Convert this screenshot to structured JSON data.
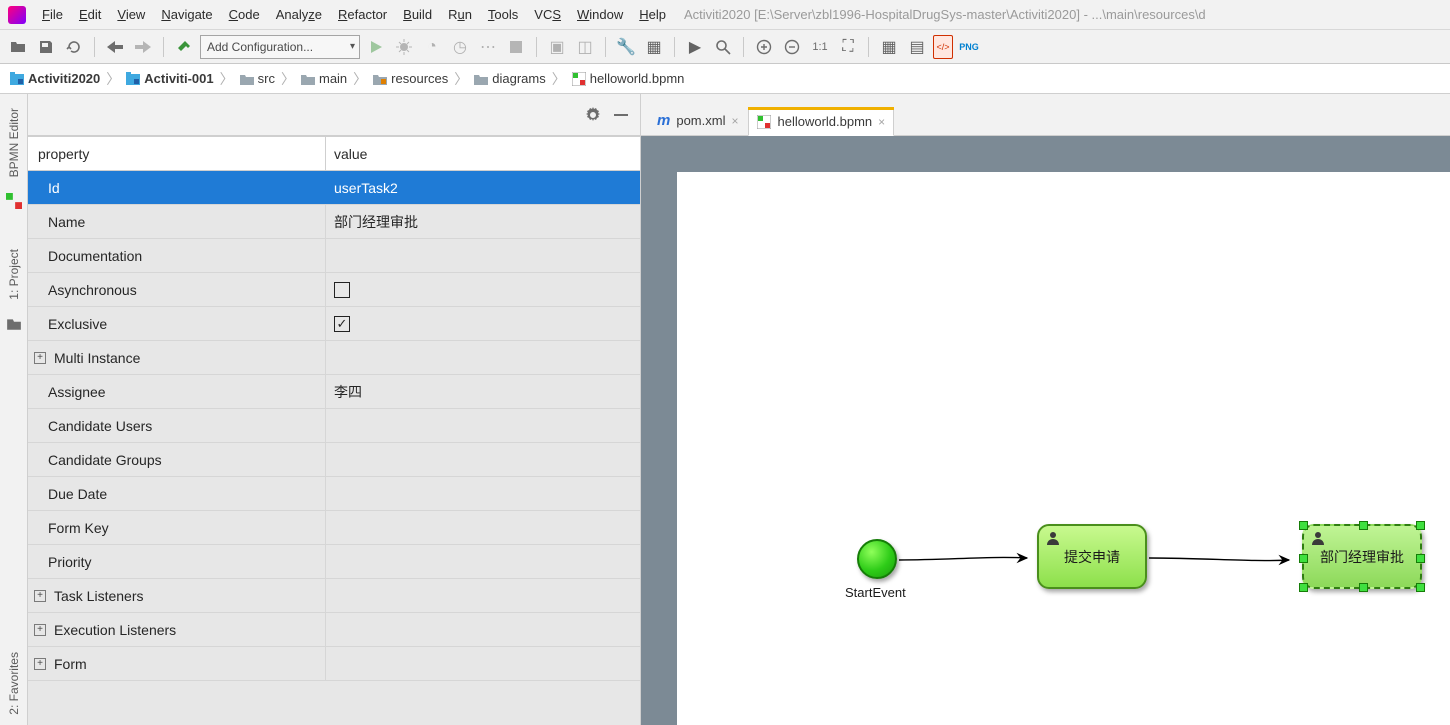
{
  "window_title": "Activiti2020 [E:\\Server\\zbl1996-HospitalDrugSys-master\\Activiti2020] - ...\\main\\resources\\d",
  "menus": [
    "File",
    "Edit",
    "View",
    "Navigate",
    "Code",
    "Analyze",
    "Refactor",
    "Build",
    "Run",
    "Tools",
    "VCS",
    "Window",
    "Help"
  ],
  "run_config_label": "Add Configuration...",
  "breadcrumb": [
    {
      "label": "Activiti2020",
      "bold": true,
      "icon": "module"
    },
    {
      "label": "Activiti-001",
      "bold": true,
      "icon": "module"
    },
    {
      "label": "src",
      "icon": "folder"
    },
    {
      "label": "main",
      "icon": "folder"
    },
    {
      "label": "resources",
      "icon": "res-folder"
    },
    {
      "label": "diagrams",
      "icon": "folder"
    },
    {
      "label": "helloworld.bpmn",
      "icon": "bpmn-file"
    }
  ],
  "left_tabs": {
    "top": "BPMN Editor",
    "middle": "1: Project",
    "bottom": "2: Favorites"
  },
  "property_table": {
    "header_key": "property",
    "header_val": "value",
    "rows": [
      {
        "k": "Id",
        "v": "userTask2",
        "selected": true
      },
      {
        "k": "Name",
        "v": "部门经理审批"
      },
      {
        "k": "Documentation",
        "v": ""
      },
      {
        "k": "Asynchronous",
        "v": "",
        "checkbox": false
      },
      {
        "k": "Exclusive",
        "v": "",
        "checkbox": true
      },
      {
        "k": "Multi Instance",
        "v": "",
        "expand": true
      },
      {
        "k": "Assignee",
        "v": "李四"
      },
      {
        "k": "Candidate Users",
        "v": ""
      },
      {
        "k": "Candidate Groups",
        "v": ""
      },
      {
        "k": "Due Date",
        "v": ""
      },
      {
        "k": "Form Key",
        "v": ""
      },
      {
        "k": "Priority",
        "v": ""
      },
      {
        "k": "Task Listeners",
        "v": "",
        "expand": true
      },
      {
        "k": "Execution Listeners",
        "v": "",
        "expand": true
      },
      {
        "k": "Form",
        "v": "",
        "expand": true
      }
    ]
  },
  "editor_tabs": [
    {
      "label": "pom.xml",
      "icon": "maven",
      "active": false
    },
    {
      "label": "helloworld.bpmn",
      "icon": "bpmn-file",
      "active": true
    }
  ],
  "diagram": {
    "start_label": "StartEvent",
    "task1_label": "提交申请",
    "task2_label": "部门经理审批"
  }
}
